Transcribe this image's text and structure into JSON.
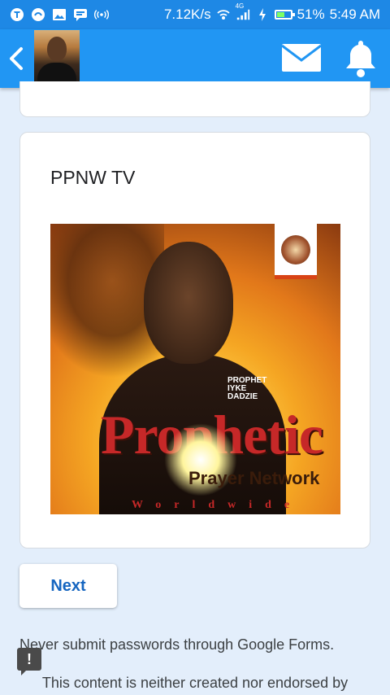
{
  "status_bar": {
    "speed": "7.12K/s",
    "network": "4G",
    "battery": "51%",
    "battery_level": 0.51,
    "time": "5:49 AM"
  },
  "app_bar": {
    "icons": [
      "back-icon",
      "mail-icon",
      "bell-icon"
    ]
  },
  "form": {
    "section_title": "PPNW TV",
    "poster": {
      "prophet_label": "PROPHET IYKE DADZIE",
      "big_word": "Prophetic",
      "sub_word": "Prayer Network",
      "ww_word": "Worldwide"
    },
    "next_label": "Next"
  },
  "footer": {
    "warning": "Never submit passwords through Google Forms.",
    "disclaimer": "This content is neither created nor endorsed by"
  },
  "colors": {
    "status_bar": "#1e88e5",
    "app_bar": "#2196f3",
    "background": "#e3eefb",
    "accent": "#1565c0"
  }
}
